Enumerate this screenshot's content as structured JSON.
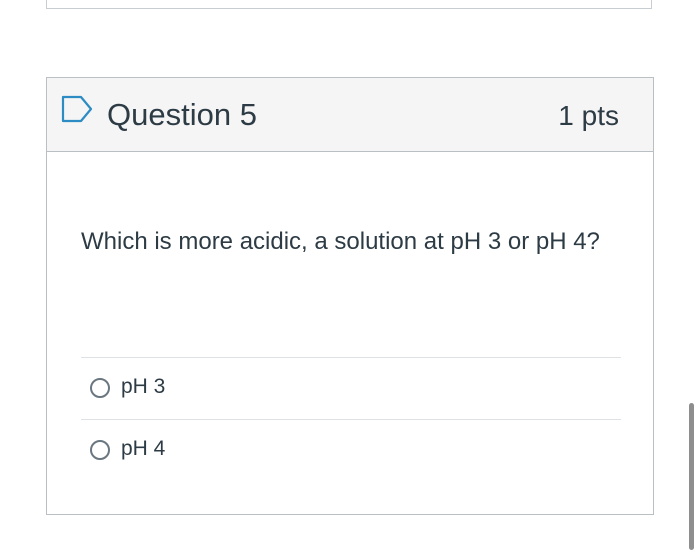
{
  "question": {
    "title": "Question 5",
    "points": "1 pts",
    "text": "Which is more acidic, a solution at pH 3 or pH 4?",
    "answers": [
      {
        "label": "pH 3",
        "selected": false
      },
      {
        "label": "pH 4",
        "selected": false
      }
    ]
  },
  "icons": {
    "flag": "bookmark-flag-icon",
    "radio": "radio-button-icon"
  },
  "colors": {
    "text": "#2d3b45",
    "header_bg": "#f5f5f5",
    "border": "#b9bfc3",
    "flag": "#2d8cc4"
  }
}
